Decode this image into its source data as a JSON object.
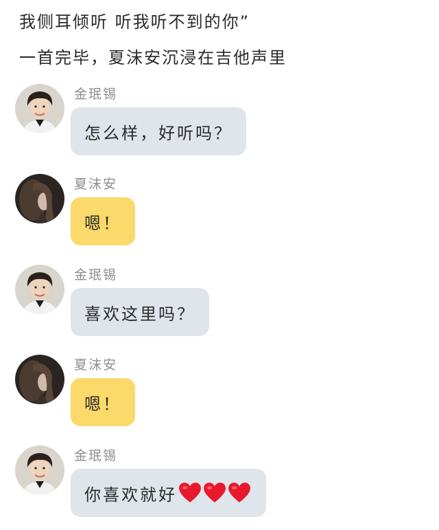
{
  "narration": {
    "line1": "我侧耳倾听 听我听不到的你”",
    "line2": "一首完毕，夏沫安沉浸在吉他声里"
  },
  "messages": [
    {
      "sender": "金珉锡",
      "text": "怎么样，好听吗？",
      "bubble_color": "#dfe5ea",
      "avatar": "male-avatar"
    },
    {
      "sender": "夏沫安",
      "text": "嗯！",
      "bubble_color": "#fbd96b",
      "avatar": "female-avatar"
    },
    {
      "sender": "金珉锡",
      "text": "喜欢这里吗？",
      "bubble_color": "#dfe5ea",
      "avatar": "male-avatar"
    },
    {
      "sender": "夏沫安",
      "text": "嗯！",
      "bubble_color": "#fbd96b",
      "avatar": "female-avatar"
    },
    {
      "sender": "金珉锡",
      "text": "你喜欢就好",
      "emoji": [
        "red-heart-icon",
        "red-heart-icon",
        "red-heart-icon"
      ],
      "bubble_color": "#dfe5ea",
      "avatar": "male-avatar"
    }
  ],
  "colors": {
    "grey_bubble": "#dfe5ea",
    "yellow_bubble": "#fbd96b",
    "heart": "#e8192c"
  }
}
